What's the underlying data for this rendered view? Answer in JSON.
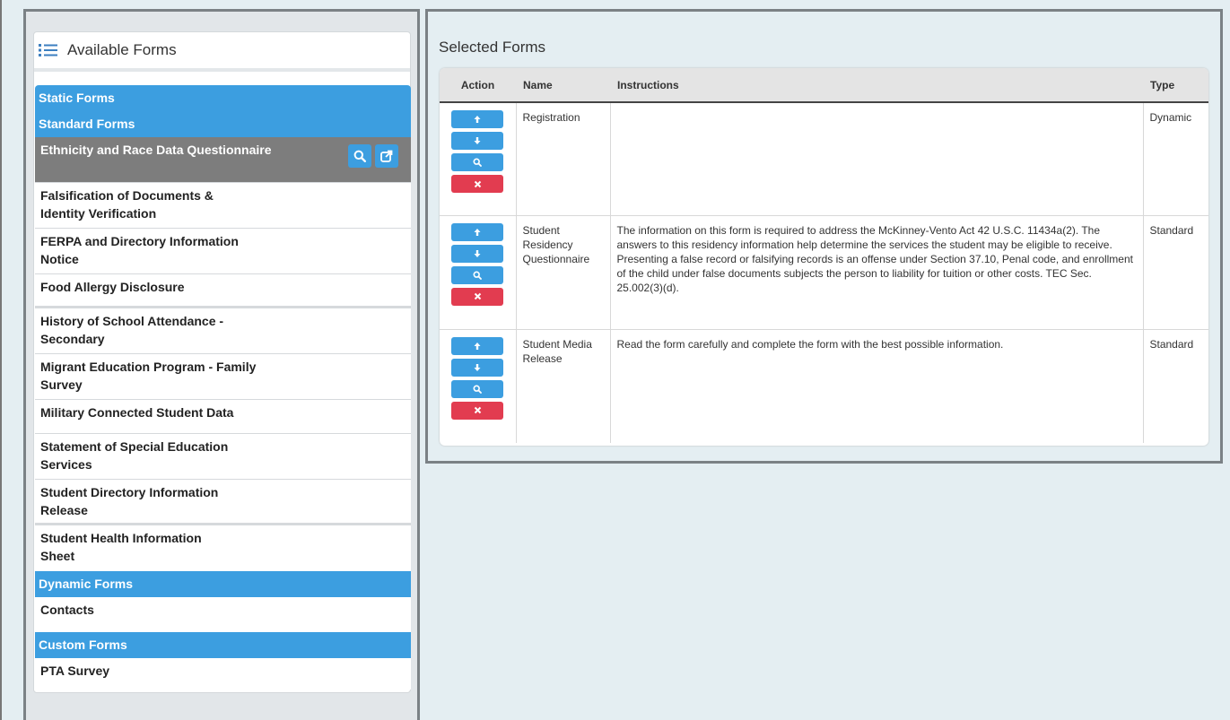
{
  "available": {
    "title": "Available Forms",
    "categories": {
      "static": "Static Forms",
      "standard": "Standard Forms",
      "dynamic": "Dynamic Forms",
      "custom": "Custom Forms"
    },
    "standard_items": [
      "Ethnicity and Race Data Questionnaire",
      "Falsification of Documents & Identity Verification",
      "FERPA and Directory Information Notice",
      "Food Allergy Disclosure",
      "History of School Attendance - Secondary",
      "Migrant Education Program - Family Survey",
      "Military Connected Student Data",
      "Statement of Special Education Services",
      "Student Directory Information Release",
      "Student Health Information Sheet"
    ],
    "dynamic_items": [
      "Contacts"
    ],
    "custom_items": [
      "PTA Survey"
    ]
  },
  "selected": {
    "title": "Selected Forms",
    "columns": {
      "action": "Action",
      "name": "Name",
      "instructions": "Instructions",
      "type": "Type"
    },
    "rows": [
      {
        "name": "Registration",
        "instructions": "",
        "type": "Dynamic"
      },
      {
        "name": "Student Residency Questionnaire",
        "instructions": "The information on this form is required to address the McKinney-Vento Act 42 U.S.C. 11434a(2). The answers to this residency information help determine the services the student may be eligible to receive. Presenting a false record or falsifying records is an offense under Section 37.10, Penal code, and enrollment of the child under false documents subjects the person to liability for tuition or other costs. TEC Sec. 25.002(3)(d).",
        "type": "Standard"
      },
      {
        "name": "Student Media Release",
        "instructions": "Read the form carefully and complete the form with the best possible information.",
        "type": "Standard"
      }
    ]
  },
  "icons": {
    "list": "list-icon",
    "search": "search-icon",
    "open": "open-external-icon",
    "up": "arrow-up-icon",
    "down": "arrow-down-icon",
    "remove": "close-icon"
  },
  "colors": {
    "accent": "#3c9ee0",
    "danger": "#e23c50",
    "active_row": "#7d7d7d"
  }
}
